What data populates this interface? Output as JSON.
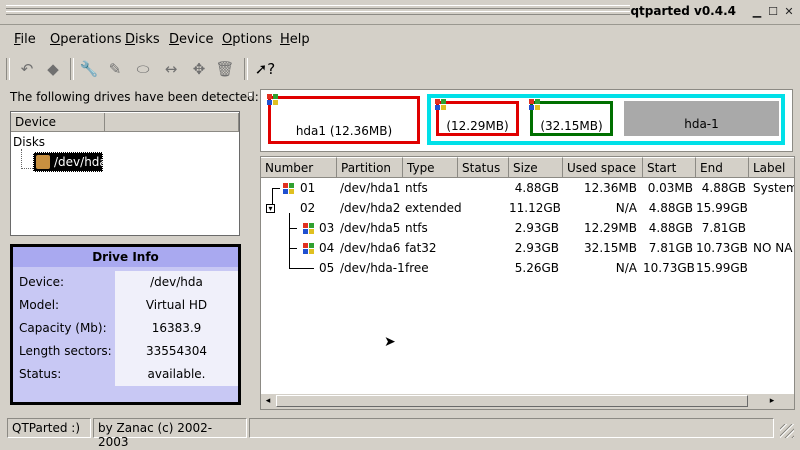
{
  "window": {
    "title": "qtparted v0.4.4"
  },
  "menu": [
    "File",
    "Operations",
    "Disks",
    "Device",
    "Options",
    "Help"
  ],
  "left": {
    "detected_label": "The following drives have been detected:",
    "tree_headers": [
      "Device",
      ""
    ],
    "tree_root": "Disks",
    "tree_item": "/dev/hda"
  },
  "drive_info": {
    "title": "Drive Info",
    "rows": [
      {
        "label": "Device:",
        "value": "/dev/hda"
      },
      {
        "label": "Model:",
        "value": "Virtual HD"
      },
      {
        "label": "Capacity (Mb):",
        "value": "16383.9"
      },
      {
        "label": "Length sectors:",
        "value": "33554304"
      },
      {
        "label": "Status:",
        "value": "available."
      }
    ]
  },
  "disk_map": {
    "hda1": "hda1 (12.36MB)",
    "hda5": "(12.29MB)",
    "hda6": "(32.15MB)",
    "free": "hda-1"
  },
  "table": {
    "headers": [
      "Number",
      "Partition",
      "Type",
      "Status",
      "Size",
      "Used space",
      "Start",
      "End",
      "Label"
    ],
    "rows": [
      {
        "number": "01",
        "partition": "/dev/hda1",
        "type": "ntfs",
        "status": "",
        "size": "4.88GB",
        "used": "12.36MB",
        "start": "0.03MB",
        "end": "4.88GB",
        "label": "System"
      },
      {
        "number": "02",
        "partition": "/dev/hda2",
        "type": "extended",
        "status": "",
        "size": "11.12GB",
        "used": "N/A",
        "start": "4.88GB",
        "end": "15.99GB",
        "label": ""
      },
      {
        "number": "03",
        "partition": "/dev/hda5",
        "type": "ntfs",
        "status": "",
        "size": "2.93GB",
        "used": "12.29MB",
        "start": "4.88GB",
        "end": "7.81GB",
        "label": ""
      },
      {
        "number": "04",
        "partition": "/dev/hda6",
        "type": "fat32",
        "status": "",
        "size": "2.93GB",
        "used": "32.15MB",
        "start": "7.81GB",
        "end": "10.73GB",
        "label": "NO NA"
      },
      {
        "number": "05",
        "partition": "/dev/hda-1",
        "type": "free",
        "status": "",
        "size": "5.26GB",
        "used": "N/A",
        "start": "10.73GB",
        "end": "15.99GB",
        "label": ""
      }
    ]
  },
  "status_bar": [
    "QTParted :)",
    "by Zanac (c) 2002-2003"
  ],
  "colors": {
    "hda1_border": "#e00000",
    "hda5_border": "#e00000",
    "hda6_border": "#007000",
    "extended_border": "#00e0e8",
    "free_fill": "#a9a9a9",
    "drive_info_header": "#a9a9f0"
  }
}
